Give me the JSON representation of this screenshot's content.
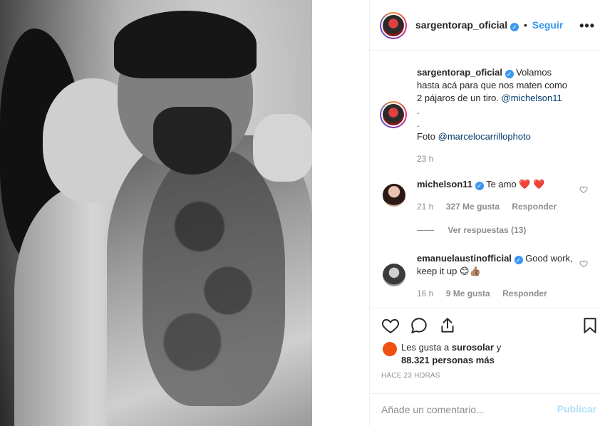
{
  "post": {
    "author": "sargentorap_oficial",
    "follow_label": "Seguir",
    "separator": "•",
    "more_label": "•••"
  },
  "caption": {
    "author": "sargentorap_oficial",
    "text": "Volamos hasta acá para que nos maten como 2 pájaros de un tiro.",
    "mention": "@michelson11",
    "dot1": ".",
    "dot2": ".",
    "photo_label": "Foto",
    "photo_credit": "@marcelocarrillophoto",
    "time": "23 h"
  },
  "comments": [
    {
      "author": "michelson11",
      "text": "Te amo",
      "emoji": "❤️ ❤️",
      "time": "21 h",
      "likes": "327 Me gusta",
      "reply": "Responder",
      "view_replies": "Ver respuestas (13)"
    },
    {
      "author": "emanuelaustinofficial",
      "text": "Good work, keep it up",
      "emoji": "😊👍🏽",
      "time": "16 h",
      "likes": "9 Me gusta",
      "reply": "Responder"
    }
  ],
  "likes": {
    "line1_prefix": "Les gusta a",
    "liker": "surosolar",
    "line1_suffix": "y",
    "line2": "88.321 personas más"
  },
  "timestamp": "HACE 23 HORAS",
  "add_comment": {
    "placeholder": "Añade un comentario...",
    "post_label": "Publicar"
  },
  "colors": {
    "accent": "#3897f0",
    "verified": "#3897f0",
    "post_disabled": "#b2dffc",
    "muted": "#8e8e8e",
    "heart_red": "#ed4956"
  }
}
